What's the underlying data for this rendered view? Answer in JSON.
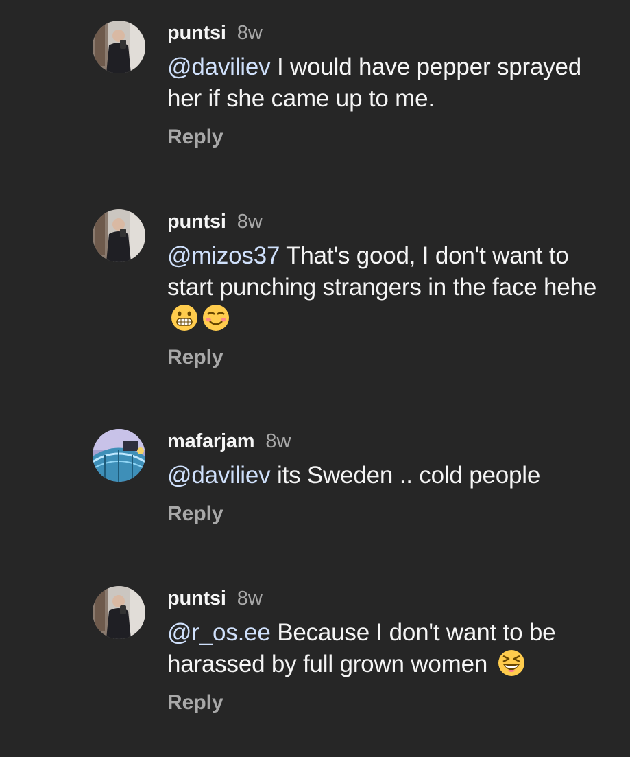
{
  "comments": [
    {
      "username": "puntsi",
      "time": "8w",
      "mention": "@daviliev",
      "text": " I would have pepper sprayed her if she came up to me.",
      "reply_label": "Reply",
      "avatar": "mirror-selfie-avatar",
      "emojis": []
    },
    {
      "username": "puntsi",
      "time": "8w",
      "mention": "@mizos37",
      "text": " That's good, I don't want to start punching strangers in the face hehe",
      "reply_label": "Reply",
      "avatar": "mirror-selfie-avatar",
      "emojis": [
        "grinning-face-icon",
        "smiling-face-icon"
      ]
    },
    {
      "username": "mafarjam",
      "time": "8w",
      "mention": "@daviliev",
      "text": " its Sweden .. cold people",
      "reply_label": "Reply",
      "avatar": "bridge-photo-avatar",
      "emojis": []
    },
    {
      "username": "puntsi",
      "time": "8w",
      "mention": "@r_os.ee",
      "text": " Because I don't want to be harassed by full grown women",
      "reply_label": "Reply",
      "avatar": "mirror-selfie-avatar",
      "emojis": [
        "laughing-squint-face-icon"
      ]
    }
  ],
  "colors": {
    "background": "#262626",
    "text": "#f5f5f5",
    "secondary": "#a8a8a8",
    "mention": "#cfe0fb"
  }
}
